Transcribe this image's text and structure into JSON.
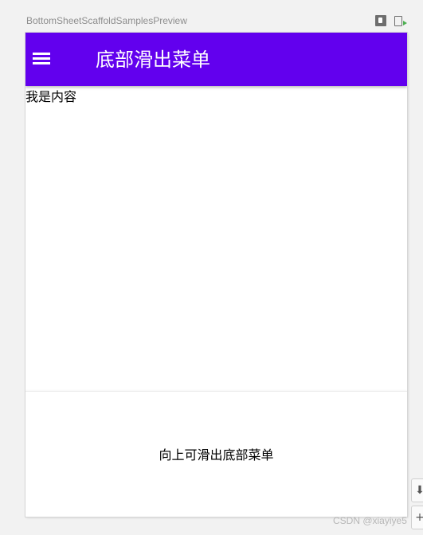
{
  "preview": {
    "title": "BottomSheetScaffoldSamplesPreview",
    "toolbar_icons": [
      "deploy-preview-icon",
      "run-preview-icon"
    ]
  },
  "appbar": {
    "title": "底部滑出菜单",
    "menu_icon": "hamburger-menu-icon",
    "color": "#6200ee"
  },
  "content": {
    "text": "我是内容"
  },
  "bottom_sheet": {
    "text": "向上可滑出底部菜单"
  },
  "side_controls": {
    "first_glyph": "⬇",
    "second_glyph": "+"
  },
  "watermark": {
    "text": "CSDN @xiayiye5"
  }
}
